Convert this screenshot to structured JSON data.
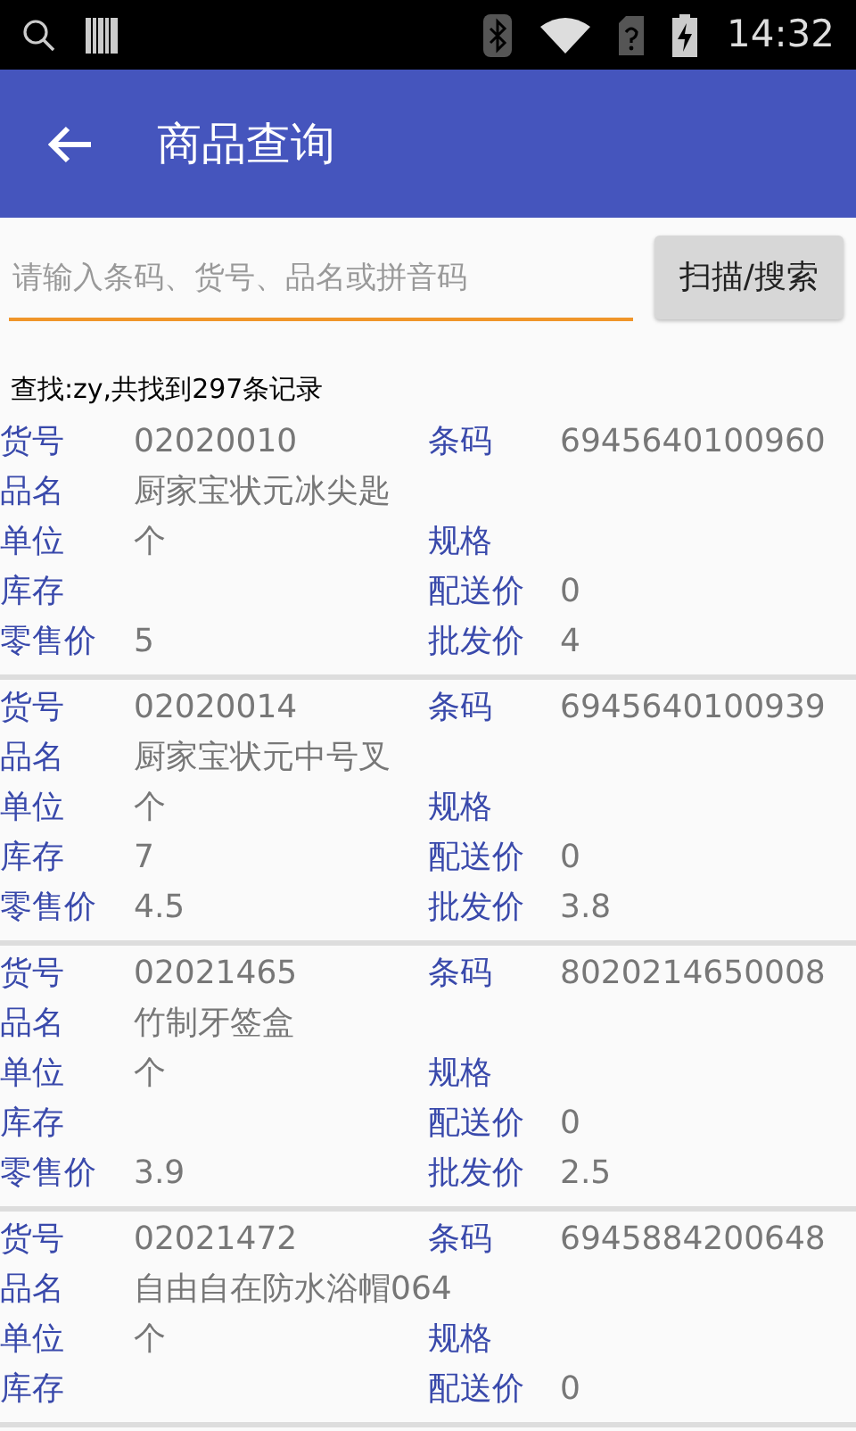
{
  "status_bar": {
    "time": "14:32"
  },
  "app_bar": {
    "title": "商品查询"
  },
  "search": {
    "placeholder": "请输入条码、货号、品名或拼音码",
    "button": "扫描/搜索"
  },
  "result_summary": "查找:zy,共找到297条记录",
  "items": [
    {
      "rows": [
        [
          {
            "label": "货号",
            "value": "02020010"
          },
          {
            "label": "条码",
            "value": "6945640100960"
          }
        ],
        [
          {
            "label": "品名",
            "value": "厨家宝状元冰尖匙"
          }
        ],
        [
          {
            "label": "单位",
            "value": "个"
          },
          {
            "label": "规格"
          }
        ],
        [
          {
            "label": "库存"
          },
          {
            "label": "配送价",
            "value": "0"
          }
        ],
        [
          {
            "label": "零售价",
            "value": "5"
          },
          {
            "label": "批发价",
            "value": "4"
          }
        ]
      ]
    },
    {
      "rows": [
        [
          {
            "label": "货号",
            "value": "02020014"
          },
          {
            "label": "条码",
            "value": "6945640100939"
          }
        ],
        [
          {
            "label": "品名",
            "value": "厨家宝状元中号叉"
          }
        ],
        [
          {
            "label": "单位",
            "value": "个"
          },
          {
            "label": "规格"
          }
        ],
        [
          {
            "label": "库存",
            "value": "7"
          },
          {
            "label": "配送价",
            "value": "0"
          }
        ],
        [
          {
            "label": "零售价",
            "value": "4.5"
          },
          {
            "label": "批发价",
            "value": "3.8"
          }
        ]
      ]
    },
    {
      "rows": [
        [
          {
            "label": "货号",
            "value": "02021465"
          },
          {
            "label": "条码",
            "value": "8020214650008"
          }
        ],
        [
          {
            "label": "品名",
            "value": "竹制牙签盒"
          }
        ],
        [
          {
            "label": "单位",
            "value": "个"
          },
          {
            "label": "规格"
          }
        ],
        [
          {
            "label": "库存"
          },
          {
            "label": "配送价",
            "value": "0"
          }
        ],
        [
          {
            "label": "零售价",
            "value": "3.9"
          },
          {
            "label": "批发价",
            "value": "2.5"
          }
        ]
      ]
    },
    {
      "rows": [
        [
          {
            "label": "货号",
            "value": "02021472"
          },
          {
            "label": "条码",
            "value": "6945884200648"
          }
        ],
        [
          {
            "label": "品名",
            "value": "自由自在防水浴帽064"
          }
        ],
        [
          {
            "label": "单位",
            "value": "个"
          },
          {
            "label": "规格"
          }
        ],
        [
          {
            "label": "库存"
          },
          {
            "label": "配送价",
            "value": "0"
          }
        ]
      ]
    }
  ]
}
